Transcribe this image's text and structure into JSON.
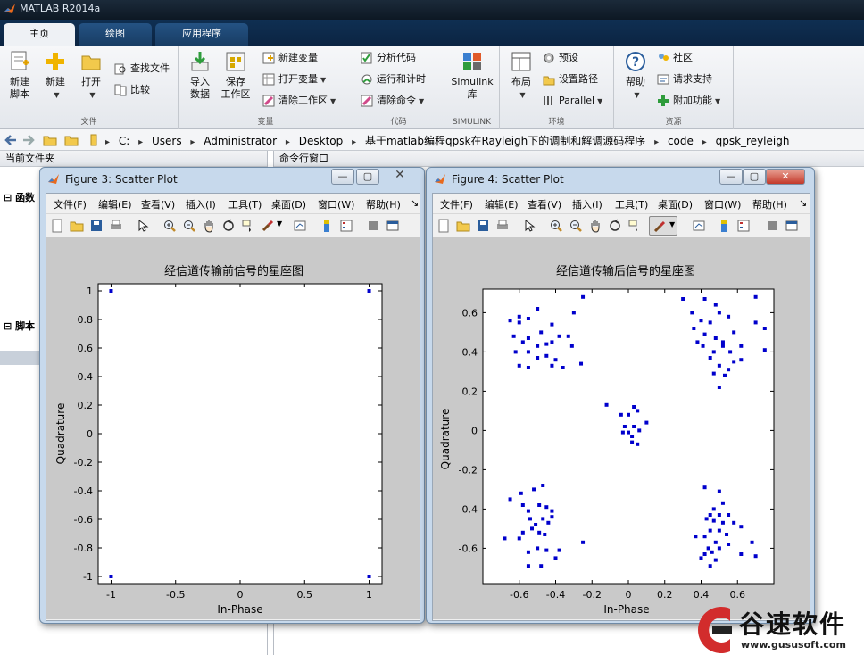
{
  "app": {
    "title": "MATLAB R2014a"
  },
  "tabs": [
    {
      "label": "主页",
      "active": true
    },
    {
      "label": "绘图",
      "active": false
    },
    {
      "label": "应用程序",
      "active": false
    }
  ],
  "ribbon": {
    "file_group": {
      "title": "文件",
      "new_script": "新建\n脚本",
      "new": "新建",
      "open": "打开",
      "find_files": "查找文件",
      "compare": "比较"
    },
    "variable_group": {
      "title": "变量",
      "import": "导入\n数据",
      "save_workspace": "保存\n工作区",
      "new_variable": "新建变量",
      "open_variable": "打开变量",
      "clear_workspace": "清除工作区"
    },
    "code_group": {
      "title": "代码",
      "analyze": "分析代码",
      "run_time": "运行和计时",
      "clear_commands": "清除命令"
    },
    "simulink_group": {
      "title": "SIMULINK",
      "library": "Simulink\n库"
    },
    "env_group": {
      "title": "环境",
      "layout": "布局",
      "preferences": "预设",
      "set_path": "设置路径",
      "parallel": "Parallel"
    },
    "resources_group": {
      "title": "资源",
      "help": "帮助",
      "community": "社区",
      "support": "请求支持",
      "addons": "附加功能"
    }
  },
  "address": {
    "path": [
      "C:",
      "Users",
      "Administrator",
      "Desktop",
      "基于matlab编程qpsk在Rayleigh下的调制和解调源码程序",
      "code",
      "qpsk_reyleigh"
    ]
  },
  "panels": {
    "current_folder": "当前文件夹",
    "command_window": "命令行窗口",
    "section_functions": "函数",
    "section_scripts": "脚本"
  },
  "figure_menu": [
    "文件(F)",
    "编辑(E)",
    "查看(V)",
    "插入(I)",
    "工具(T)",
    "桌面(D)",
    "窗口(W)",
    "帮助(H)"
  ],
  "fig3": {
    "window_title": "Figure 3: Scatter Plot",
    "chart_data": {
      "type": "scatter",
      "title": "经信道传输前信号的星座图",
      "xlabel": "In-Phase",
      "ylabel": "Quadrature",
      "xlim": [
        -1.1,
        1.1
      ],
      "ylim": [
        -1.05,
        1.05
      ],
      "xticks": [
        -1,
        -0.5,
        0,
        0.5,
        1
      ],
      "yticks": [
        -1,
        -0.8,
        -0.6,
        -0.4,
        -0.2,
        0,
        0.2,
        0.4,
        0.6,
        0.8,
        1
      ],
      "points": [
        [
          -1,
          1
        ],
        [
          1,
          1
        ],
        [
          -1,
          -1
        ],
        [
          1,
          -1
        ]
      ],
      "color": "#0000cc"
    }
  },
  "fig4": {
    "window_title": "Figure 4: Scatter Plot",
    "chart_data": {
      "type": "scatter",
      "title": "经信道传输后信号的星座图",
      "xlabel": "In-Phase",
      "ylabel": "Quadrature",
      "xlim": [
        -0.8,
        0.8
      ],
      "ylim": [
        -0.78,
        0.72
      ],
      "xticks": [
        -0.6,
        -0.4,
        -0.2,
        0,
        0.2,
        0.4,
        0.6
      ],
      "yticks": [
        -0.6,
        -0.4,
        -0.2,
        0,
        0.2,
        0.4,
        0.6
      ],
      "color": "#0000cc",
      "points": [
        [
          -0.65,
          0.56
        ],
        [
          -0.6,
          0.58
        ],
        [
          -0.6,
          0.55
        ],
        [
          -0.55,
          0.57
        ],
        [
          -0.5,
          0.62
        ],
        [
          -0.48,
          0.5
        ],
        [
          -0.42,
          0.54
        ],
        [
          -0.3,
          0.6
        ],
        [
          -0.25,
          0.68
        ],
        [
          -0.63,
          0.48
        ],
        [
          -0.58,
          0.45
        ],
        [
          -0.55,
          0.47
        ],
        [
          -0.5,
          0.43
        ],
        [
          -0.45,
          0.44
        ],
        [
          -0.42,
          0.45
        ],
        [
          -0.38,
          0.48
        ],
        [
          -0.33,
          0.48
        ],
        [
          -0.31,
          0.43
        ],
        [
          -0.62,
          0.4
        ],
        [
          -0.55,
          0.4
        ],
        [
          -0.5,
          0.37
        ],
        [
          -0.45,
          0.38
        ],
        [
          -0.4,
          0.36
        ],
        [
          -0.6,
          0.33
        ],
        [
          -0.55,
          0.32
        ],
        [
          -0.42,
          0.33
        ],
        [
          -0.36,
          0.32
        ],
        [
          -0.26,
          0.34
        ],
        [
          0.3,
          0.67
        ],
        [
          0.35,
          0.6
        ],
        [
          0.4,
          0.56
        ],
        [
          0.42,
          0.67
        ],
        [
          0.48,
          0.64
        ],
        [
          0.5,
          0.6
        ],
        [
          0.55,
          0.58
        ],
        [
          0.7,
          0.68
        ],
        [
          0.36,
          0.52
        ],
        [
          0.42,
          0.49
        ],
        [
          0.45,
          0.55
        ],
        [
          0.48,
          0.47
        ],
        [
          0.52,
          0.45
        ],
        [
          0.58,
          0.5
        ],
        [
          0.7,
          0.55
        ],
        [
          0.75,
          0.52
        ],
        [
          0.38,
          0.45
        ],
        [
          0.41,
          0.43
        ],
        [
          0.47,
          0.4
        ],
        [
          0.52,
          0.43
        ],
        [
          0.56,
          0.4
        ],
        [
          0.62,
          0.43
        ],
        [
          0.45,
          0.37
        ],
        [
          0.5,
          0.33
        ],
        [
          0.58,
          0.35
        ],
        [
          0.62,
          0.36
        ],
        [
          0.47,
          0.29
        ],
        [
          0.53,
          0.28
        ],
        [
          0.55,
          0.31
        ],
        [
          0.75,
          0.41
        ],
        [
          0.5,
          0.22
        ],
        [
          -0.12,
          0.13
        ],
        [
          -0.04,
          0.08
        ],
        [
          0.0,
          0.08
        ],
        [
          0.03,
          0.12
        ],
        [
          0.05,
          0.1
        ],
        [
          -0.02,
          0.02
        ],
        [
          0.1,
          0.04
        ],
        [
          -0.03,
          -0.01
        ],
        [
          0.0,
          -0.01
        ],
        [
          0.02,
          -0.03
        ],
        [
          0.03,
          0.02
        ],
        [
          0.06,
          0.0
        ],
        [
          0.05,
          -0.07
        ],
        [
          0.02,
          -0.06
        ],
        [
          -0.65,
          -0.35
        ],
        [
          -0.59,
          -0.32
        ],
        [
          -0.52,
          -0.3
        ],
        [
          -0.47,
          -0.28
        ],
        [
          -0.58,
          -0.38
        ],
        [
          -0.55,
          -0.41
        ],
        [
          -0.49,
          -0.38
        ],
        [
          -0.45,
          -0.39
        ],
        [
          -0.42,
          -0.41
        ],
        [
          -0.54,
          -0.45
        ],
        [
          -0.51,
          -0.48
        ],
        [
          -0.47,
          -0.45
        ],
        [
          -0.44,
          -0.47
        ],
        [
          -0.42,
          -0.44
        ],
        [
          -0.58,
          -0.52
        ],
        [
          -0.53,
          -0.5
        ],
        [
          -0.49,
          -0.52
        ],
        [
          -0.46,
          -0.53
        ],
        [
          -0.6,
          -0.55
        ],
        [
          -0.68,
          -0.55
        ],
        [
          -0.55,
          -0.62
        ],
        [
          -0.5,
          -0.6
        ],
        [
          -0.45,
          -0.61
        ],
        [
          -0.38,
          -0.61
        ],
        [
          -0.25,
          -0.57
        ],
        [
          -0.48,
          -0.69
        ],
        [
          -0.4,
          -0.65
        ],
        [
          -0.55,
          -0.69
        ],
        [
          0.42,
          -0.29
        ],
        [
          0.5,
          -0.31
        ],
        [
          0.52,
          -0.37
        ],
        [
          0.47,
          -0.4
        ],
        [
          0.45,
          -0.43
        ],
        [
          0.43,
          -0.45
        ],
        [
          0.5,
          -0.43
        ],
        [
          0.55,
          -0.43
        ],
        [
          0.47,
          -0.46
        ],
        [
          0.52,
          -0.47
        ],
        [
          0.58,
          -0.47
        ],
        [
          0.62,
          -0.49
        ],
        [
          0.45,
          -0.51
        ],
        [
          0.5,
          -0.51
        ],
        [
          0.54,
          -0.53
        ],
        [
          0.37,
          -0.54
        ],
        [
          0.42,
          -0.54
        ],
        [
          0.48,
          -0.57
        ],
        [
          0.55,
          -0.58
        ],
        [
          0.68,
          -0.57
        ],
        [
          0.44,
          -0.6
        ],
        [
          0.5,
          -0.6
        ],
        [
          0.42,
          -0.63
        ],
        [
          0.46,
          -0.62
        ],
        [
          0.48,
          -0.66
        ],
        [
          0.45,
          -0.69
        ],
        [
          0.62,
          -0.63
        ],
        [
          0.7,
          -0.64
        ],
        [
          0.4,
          -0.65
        ]
      ]
    }
  },
  "watermark": {
    "brand": "谷速软件",
    "url": "www.gususoft.com"
  }
}
